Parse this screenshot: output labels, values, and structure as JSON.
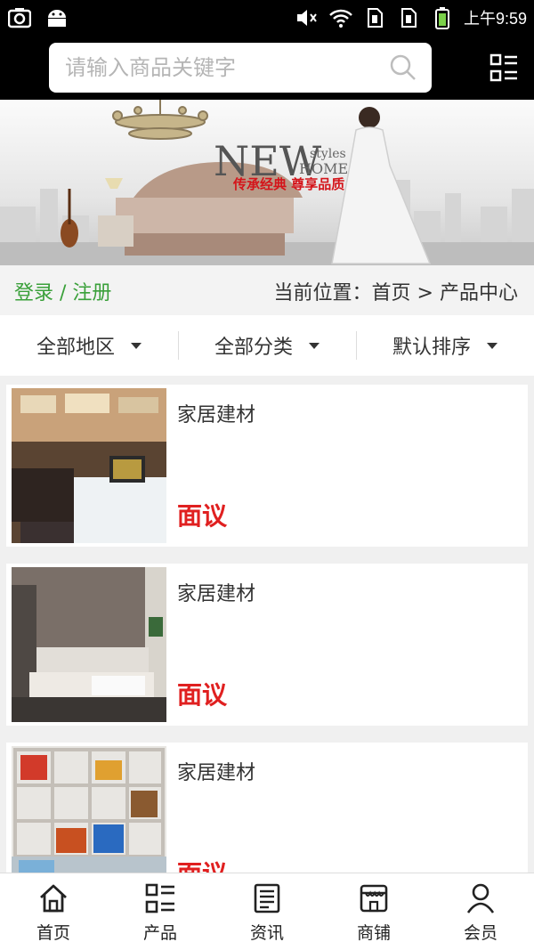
{
  "status_bar": {
    "time": "上午9:59"
  },
  "search": {
    "placeholder": "请输入商品关键字"
  },
  "banner": {
    "headline": "NEW",
    "headline_sub_1": "styles",
    "headline_sub_2": "HOME",
    "slogan": "传承经典 尊享品质",
    "colors": {
      "slogan": "#d4141a"
    }
  },
  "infobar": {
    "login_label": "登录",
    "separator": " / ",
    "register_label": "注册",
    "breadcrumb_prefix": "当前位置：",
    "breadcrumb_home": "首页",
    "breadcrumb_sep": " > ",
    "breadcrumb_current": "产品中心"
  },
  "filters": [
    {
      "label": "全部地区"
    },
    {
      "label": "全部分类"
    },
    {
      "label": "默认排序"
    }
  ],
  "products": [
    {
      "title": "家居建材",
      "price": "面议"
    },
    {
      "title": "家居建材",
      "price": "面议"
    },
    {
      "title": "家居建材",
      "price": "面议"
    }
  ],
  "tabbar": [
    {
      "label": "首页",
      "icon": "home-icon"
    },
    {
      "label": "产品",
      "icon": "grid-list-icon"
    },
    {
      "label": "资讯",
      "icon": "news-icon"
    },
    {
      "label": "商铺",
      "icon": "store-icon"
    },
    {
      "label": "会员",
      "icon": "user-icon"
    }
  ],
  "colors": {
    "accent_green": "#3aa03a",
    "price_red": "#e02020",
    "header_black": "#000000"
  }
}
